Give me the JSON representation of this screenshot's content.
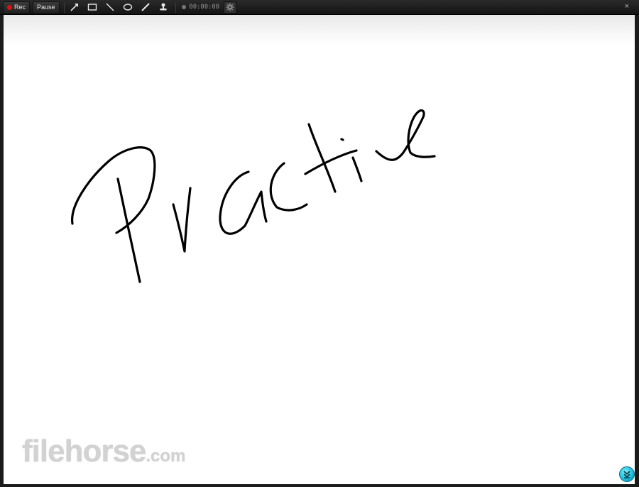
{
  "toolbar": {
    "rec_label": "Rec",
    "pause_label": "Pause",
    "tools": [
      {
        "name": "arrow-tool",
        "icon": "arrow-icon"
      },
      {
        "name": "rectangle-tool",
        "icon": "rectangle-icon"
      },
      {
        "name": "line-tool",
        "icon": "line-icon"
      },
      {
        "name": "ellipse-tool",
        "icon": "ellipse-icon"
      },
      {
        "name": "pen-tool",
        "icon": "pen-icon"
      },
      {
        "name": "stamp-tool",
        "icon": "stamp-icon"
      }
    ],
    "timer": "00:00:00",
    "settings_icon": "gear-icon",
    "close_symbol": "×"
  },
  "canvas": {
    "drawn_text": "Practice",
    "stroke_color": "#000000",
    "background_color": "#ffffff"
  },
  "watermark": {
    "main": "filehorse",
    "suffix": ".com"
  },
  "colors": {
    "record_red": "#e01010",
    "collapse_button_cyan": "#15b8d8"
  },
  "collapse_button_icon": "double-chevron-down-icon"
}
